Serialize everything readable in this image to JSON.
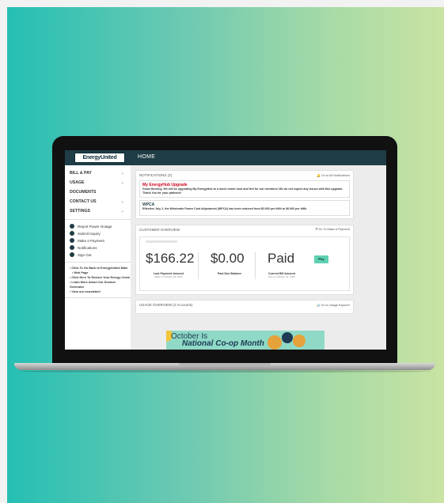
{
  "header": {
    "logo_text": "EnergyUnited",
    "page_title": "HOME"
  },
  "sidebar": {
    "nav": [
      {
        "label": "BILL & PAY",
        "chevron": "⌄"
      },
      {
        "label": "USAGE",
        "chevron": "⌄"
      },
      {
        "label": "DOCUMENTS",
        "chevron": ""
      },
      {
        "label": "CONTACT US",
        "chevron": "⌄"
      },
      {
        "label": "SETTINGS",
        "chevron": "⌄"
      }
    ],
    "quick": [
      {
        "label": "Report Power Outage",
        "icon": "bolt-icon"
      },
      {
        "label": "Submit Inquiry",
        "icon": "question-icon"
      },
      {
        "label": "Make a Payment",
        "icon": "dollar-icon"
      },
      {
        "label": "Notifications",
        "icon": "bell-icon"
      },
      {
        "label": "Sign Out",
        "icon": "power-icon"
      }
    ],
    "links": [
      "Click To Go Back to EnergyUnited Main",
      "Web Page",
      "Click Here To Reduce Your Energy Costs",
      "Learn More About Our Dunmor Generator",
      "View our newsletter!"
    ]
  },
  "notifications": {
    "title": "NOTIFICATIONS (2)",
    "go_all": "Go to All Notifications",
    "items": [
      {
        "title": "My EnergyHub Upgrade",
        "body": "Good Morning. We will be upgrading My EnergyHub to a much newer look and feel for our members! We do not expect any issues with this upgrade. Thank You for your patience!"
      },
      {
        "title": "WPCA",
        "body": "Effective July 1, the Wholesale Power Cost Adjustment (WPCA) has been reduced from $0.000 per kWh to $0.000 per kWh."
      }
    ]
  },
  "customer": {
    "title": "CUSTOMER OVERVIEW",
    "go_payment": "Go To Make A Payment",
    "last_payment": "$166.22",
    "last_payment_label": "Last Payment Amount",
    "last_payment_sub": "PAID on October 16, 2023",
    "past_due": "$0.00",
    "past_due_label": "Past Due Balance",
    "status": "Paid",
    "current_label": "Current Bill Amount",
    "current_sub": "Due on October 31, 2023",
    "pay_button": "Pay"
  },
  "usage": {
    "title": "USAGE OVERVIEW (2 Accounts)",
    "go_usage": "Go to Usage Explorer"
  },
  "banner": {
    "line1": "October Is",
    "line2": "National Co-op Month"
  }
}
